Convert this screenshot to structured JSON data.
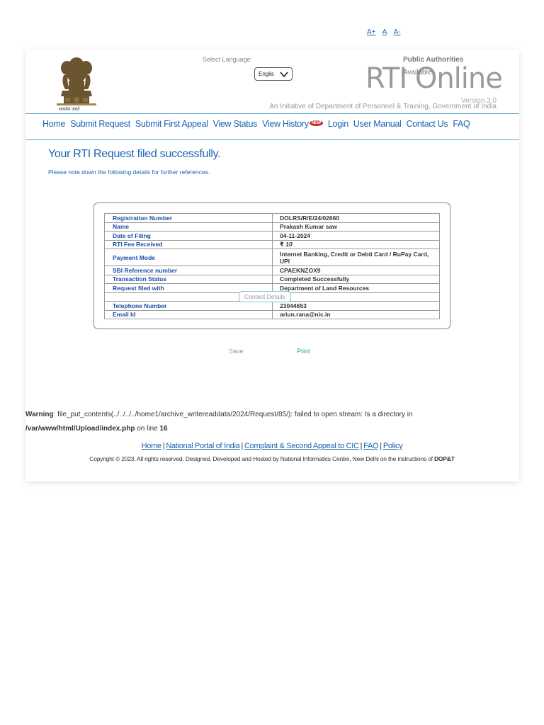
{
  "font_controls": [
    "A+",
    "A",
    "A-"
  ],
  "header": {
    "emblem_caption": "सत्यमेव जयते",
    "select_language_label": "Select Language:",
    "language_value": "Englis",
    "public_authorities": "Public Authorities",
    "available": "Available",
    "site_title": "RTI Online",
    "version": "Version 2.0",
    "initiative": "An Initiative of Department of Personnel & Training, Government of India"
  },
  "nav": {
    "items": [
      "Home",
      "Submit Request",
      "Submit First Appeal",
      "View Status",
      "View History",
      "Login",
      "User Manual",
      "Contact Us",
      "FAQ"
    ],
    "new_badge": "NEW"
  },
  "main": {
    "title": "Your RTI Request filed successfully.",
    "note": "Please note down the following details for further references."
  },
  "details": {
    "rows": [
      {
        "label": "Registration Number",
        "value": "DOLRS/R/E/24/02660"
      },
      {
        "label": "Name",
        "value": "Prakash Kumar saw"
      },
      {
        "label": "Date of Filing",
        "value": "04-11-2024"
      },
      {
        "label": "RTI Fee Received",
        "value": "10",
        "currency_symbol": "₹"
      },
      {
        "label": "Payment Mode",
        "value": "Internet Banking, Credit or Debit Card / RuPay Card, UPI"
      },
      {
        "label": "SBI Reference number",
        "value": "CPAEKNZOX9"
      },
      {
        "label": "Transaction Status",
        "value": "Completed Successfully"
      },
      {
        "label": "Request filed with",
        "value": "Department of Land Resources"
      },
      {
        "label": "Telephone Number",
        "value": "23044653"
      },
      {
        "label": "Email Id",
        "value": "ariun.rana@nic.in"
      }
    ],
    "contact_section": "Contact Details"
  },
  "actions": {
    "save": "Save",
    "print": "Print"
  },
  "warning": {
    "prefix": "Warning",
    "message": ": file_put_contents(../../../../home1/archive_writereaddata/2024/Request/85/): failed to open stream: Is a directory in",
    "path": "/var/www/html/Upload/index.php",
    "on_line": " on line ",
    "line": "16"
  },
  "footer": {
    "links": [
      "Home",
      "National Portal of India",
      "Complaint & Second Appeal to CIC",
      "FAQ",
      "Policy"
    ],
    "separator": "|",
    "copyright": "Copyright © 2023. All rights reserved. Designed, Developed and Hosted by National Informatics Centre, New Delhi on the instructions of",
    "copyright_bold": "DOP&T"
  },
  "colors": {
    "link": "#1a63b0",
    "rule": "#5ca3c8",
    "title_gray": "#9a9a9a",
    "badge": "#c62828"
  }
}
